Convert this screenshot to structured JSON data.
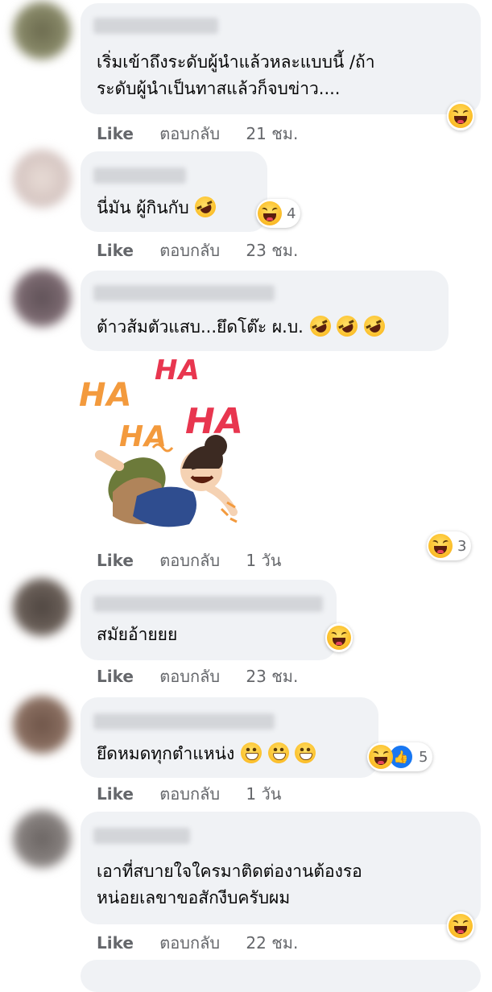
{
  "labels": {
    "like": "Like",
    "reply": "ตอบกลับ"
  },
  "comments": [
    {
      "lines": [
        "เริ่มเข้าถึงระดับผู้นำแล้วหละแบบนี้ /ถ้า",
        "ระดับผู้นำเป็นทาสแล้วก็จบข่าว...."
      ],
      "time": "21 ชม.",
      "reaction_icons": [
        "haha-icon"
      ],
      "reaction_count": ""
    },
    {
      "lines": [
        "นี่มัน ผู้กินกับ"
      ],
      "time": "23 ชม.",
      "reaction_icons": [
        "haha-icon"
      ],
      "reaction_count": "4"
    },
    {
      "lines": [
        "ต้าวส้มตัวแสบ...ยึดโต๊ะ ผ.บ."
      ],
      "time": "1 วัน",
      "reaction_icons": [
        "haha-icon"
      ],
      "reaction_count": "3",
      "sticker": {
        "words": [
          "HA",
          "HA",
          "HA",
          "HA"
        ]
      }
    },
    {
      "lines": [
        "สมัยอ้ายยย"
      ],
      "time": "23 ชม.",
      "reaction_icons": [
        "haha-icon"
      ],
      "reaction_count": ""
    },
    {
      "lines": [
        "ยึดหมดทุกตำแหน่ง"
      ],
      "time": "1 วัน",
      "reaction_icons": [
        "haha-icon",
        "like-icon"
      ],
      "reaction_count": "5"
    },
    {
      "lines": [
        "เอาที่สบายใจใครมาติดต่องานต้องรอ",
        "หน่อยเลขาขอสักงีบครับผม"
      ],
      "time": "22 ชม.",
      "reaction_icons": [
        "haha-icon"
      ],
      "reaction_count": ""
    }
  ],
  "colors": {
    "bubble": "#f0f2f5",
    "meta": "#65676b",
    "like_blue": "#1877f2",
    "ha_red": "#e8364f",
    "ha_orange": "#f39a3d"
  }
}
